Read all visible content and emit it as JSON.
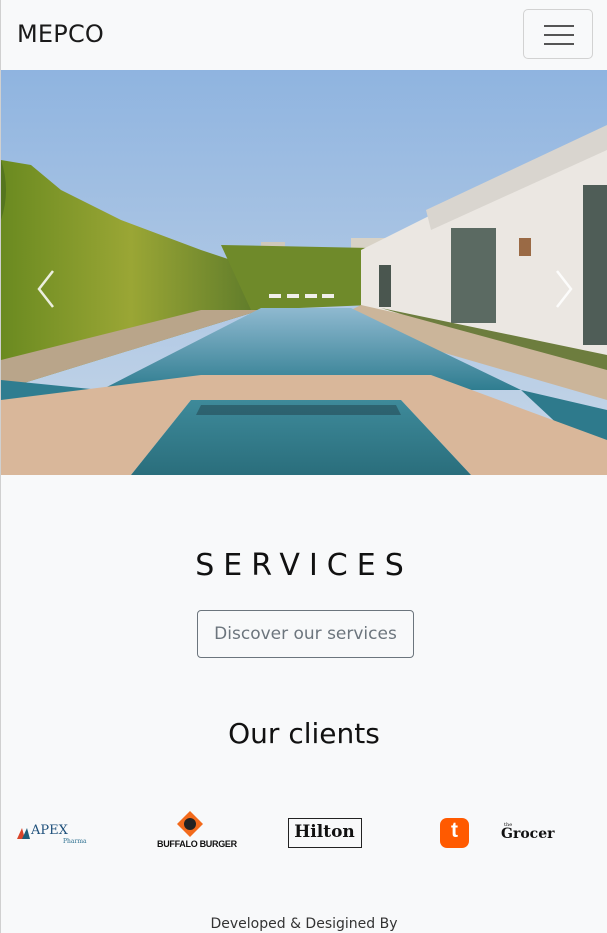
{
  "navbar": {
    "brand": "MEPCO",
    "menu_icon": "hamburger-icon"
  },
  "carousel": {
    "image_alt": "pool-villa-photo",
    "prev_icon": "chevron-left-icon",
    "next_icon": "chevron-right-icon"
  },
  "services": {
    "title": "SERVICES",
    "button_label": "Discover our services"
  },
  "clients": {
    "title": "Our clients",
    "logos": [
      {
        "name": "apex-pharma-logo",
        "text": "APEX",
        "subtext": "Pharma"
      },
      {
        "name": "buffalo-burger-logo",
        "text": "BUFFALO BURGER"
      },
      {
        "name": "hilton-logo",
        "text": "Hilton"
      },
      {
        "name": "talabat-logo",
        "text": "t"
      },
      {
        "name": "the-grocer-logo",
        "text": "Grocer",
        "pretext": "the"
      }
    ]
  },
  "footer": {
    "credit": "Developed & Desigined By"
  },
  "colors": {
    "background": "#f8f9fa",
    "button_outline": "#6c757d",
    "talabat_orange": "#ff5a00",
    "buffalo_orange": "#f26a1b"
  }
}
